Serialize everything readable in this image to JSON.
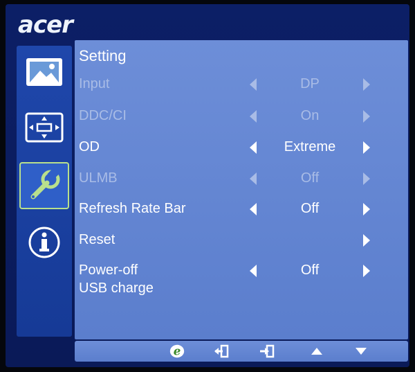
{
  "brand": {
    "logo": "acer"
  },
  "sidebar": {
    "items": [
      {
        "icon": "picture-icon",
        "active": false
      },
      {
        "icon": "display-position-icon",
        "active": false
      },
      {
        "icon": "wrench-icon",
        "active": true
      },
      {
        "icon": "info-icon",
        "active": false
      }
    ]
  },
  "panel": {
    "title": "Setting",
    "rows": [
      {
        "label": "Input",
        "value": "DP",
        "enabled": false,
        "left_arrow": true,
        "right_arrow": true
      },
      {
        "label": "DDC/CI",
        "value": "On",
        "enabled": false,
        "left_arrow": true,
        "right_arrow": true
      },
      {
        "label": "OD",
        "value": "Extreme",
        "enabled": true,
        "left_arrow": true,
        "right_arrow": true
      },
      {
        "label": "ULMB",
        "value": "Off",
        "enabled": false,
        "left_arrow": true,
        "right_arrow": true
      },
      {
        "label": "Refresh Rate Bar",
        "value": "Off",
        "enabled": true,
        "left_arrow": true,
        "right_arrow": true
      },
      {
        "label": "Reset",
        "value": "",
        "enabled": true,
        "left_arrow": false,
        "right_arrow": true
      },
      {
        "label": "Power-off",
        "label_line2": "USB charge",
        "value": "Off",
        "enabled": true,
        "left_arrow": true,
        "right_arrow": true
      }
    ]
  },
  "bottombar": {
    "buttons": [
      "e-key-icon",
      "exit-icon",
      "enter-icon",
      "up-icon",
      "down-icon"
    ]
  },
  "colors": {
    "osd_bg": "#0c1f66",
    "sidebar_bg": "#1f47ab",
    "panel_bg": "#6d8ed8",
    "active_border": "#b9e08c",
    "disabled_text": "#a9bce6"
  }
}
